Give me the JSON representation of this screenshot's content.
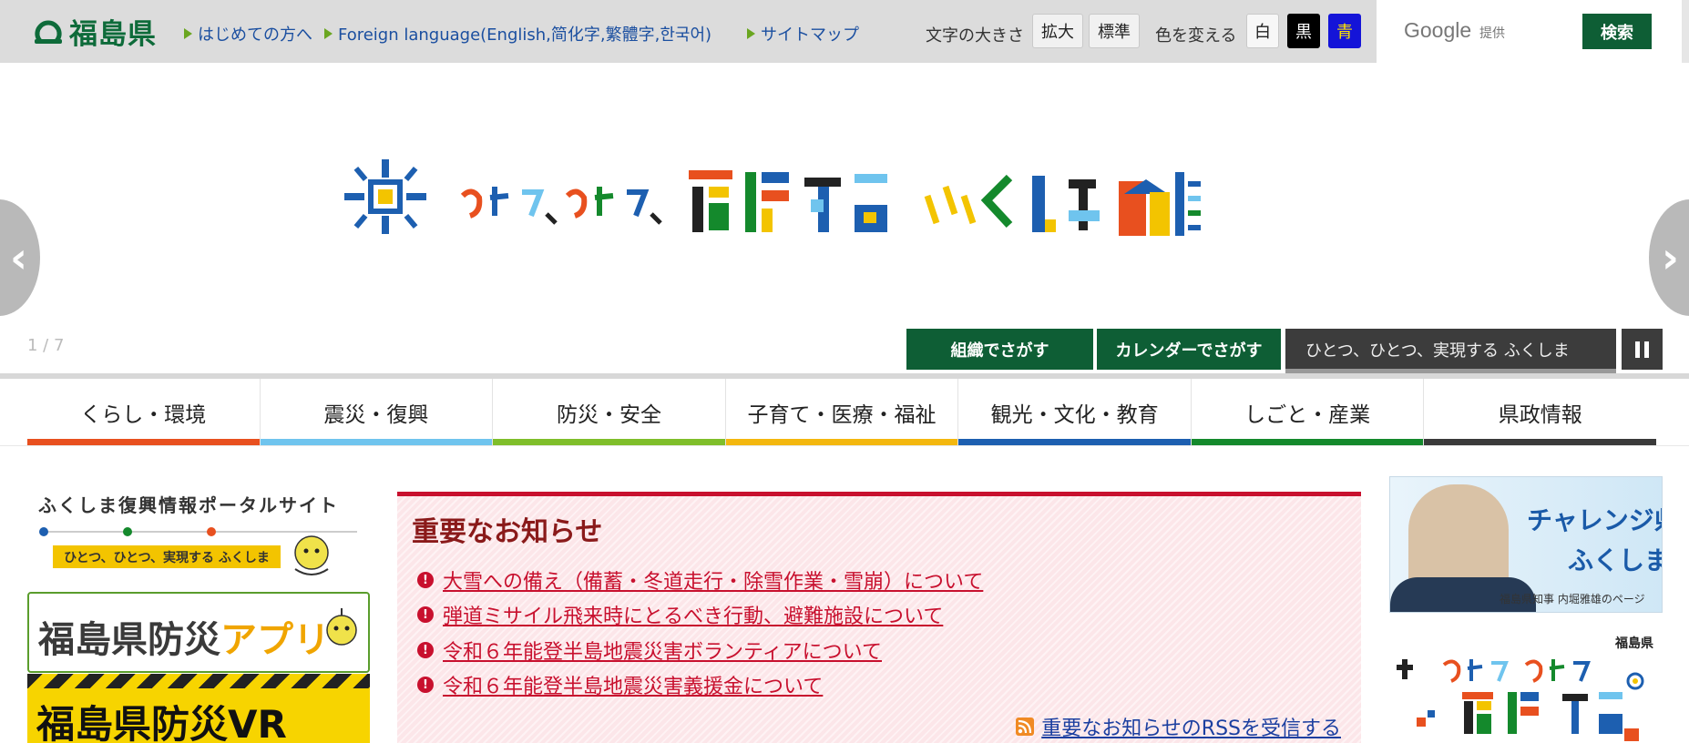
{
  "header": {
    "logo_text": "福島県",
    "links": [
      {
        "label": "はじめての方へ"
      },
      {
        "label": "Foreign language(English,简化字,繁體字,한국어)"
      },
      {
        "label": "サイトマップ"
      }
    ],
    "font_size": {
      "label": "文字の大きさ",
      "enlarge": "拡大",
      "standard": "標準"
    },
    "color_change": {
      "label": "色を変える",
      "white": "白",
      "black": "黒",
      "blue": "青"
    },
    "search": {
      "provider": "Google",
      "provided": "提供",
      "button": "検索"
    }
  },
  "hero": {
    "slide_counter": "1 / 7",
    "buttons": {
      "org": "組織でさがす",
      "calendar": "カレンダーでさがす"
    },
    "caption": "ひとつ、ひとつ、実現する ふくしま"
  },
  "nav": {
    "items": [
      {
        "label": "くらし・環境",
        "color": "#e8501f"
      },
      {
        "label": "震災・復興",
        "color": "#6fc4ee"
      },
      {
        "label": "防災・安全",
        "color": "#7fbe2a"
      },
      {
        "label": "子育て・医療・福祉",
        "color": "#f3b70e"
      },
      {
        "label": "観光・文化・教育",
        "color": "#1d5fb0"
      },
      {
        "label": "しごと・産業",
        "color": "#14892c"
      },
      {
        "label": "県政情報",
        "color": "#3a3a3a"
      }
    ]
  },
  "left_banners": {
    "portal_title": "ふくしま復興情報ポータルサイト",
    "portal_tag": "ひとつ、ひとつ、実現する ふくしま",
    "app_title_a": "福島県防災",
    "app_title_b": "アプリ",
    "vr_title": "福島県防災VR"
  },
  "notices": {
    "title": "重要なお知らせ",
    "items": [
      "大雪への備え（備蓄・冬道走行・除雪作業・雪崩）について",
      "弾道ミサイル飛来時にとるべき行動、避難施設について",
      "令和６年能登半島地震災害ボランティアについて",
      "令和６年能登半島地震災害義援金について"
    ],
    "rss": "重要なお知らせのRSSを受信する"
  },
  "right_banners": {
    "challenge_line1": "チャレンジ県",
    "challenge_line2": "ふくしま!",
    "challenge_sub": "福島県知事 内堀雅雄のページ",
    "pref_label": "福島県"
  },
  "colors": {
    "brand_green": "#0e6b3a",
    "nav_dark_green": "#0e5e35",
    "notice_red": "#c8102e",
    "link_blue": "#1b4fa0"
  },
  "icons": [
    "logo-mark-icon",
    "triangle-bullet-icon",
    "chevron-left-icon",
    "chevron-right-icon",
    "pause-icon",
    "alert-icon",
    "rss-icon"
  ]
}
